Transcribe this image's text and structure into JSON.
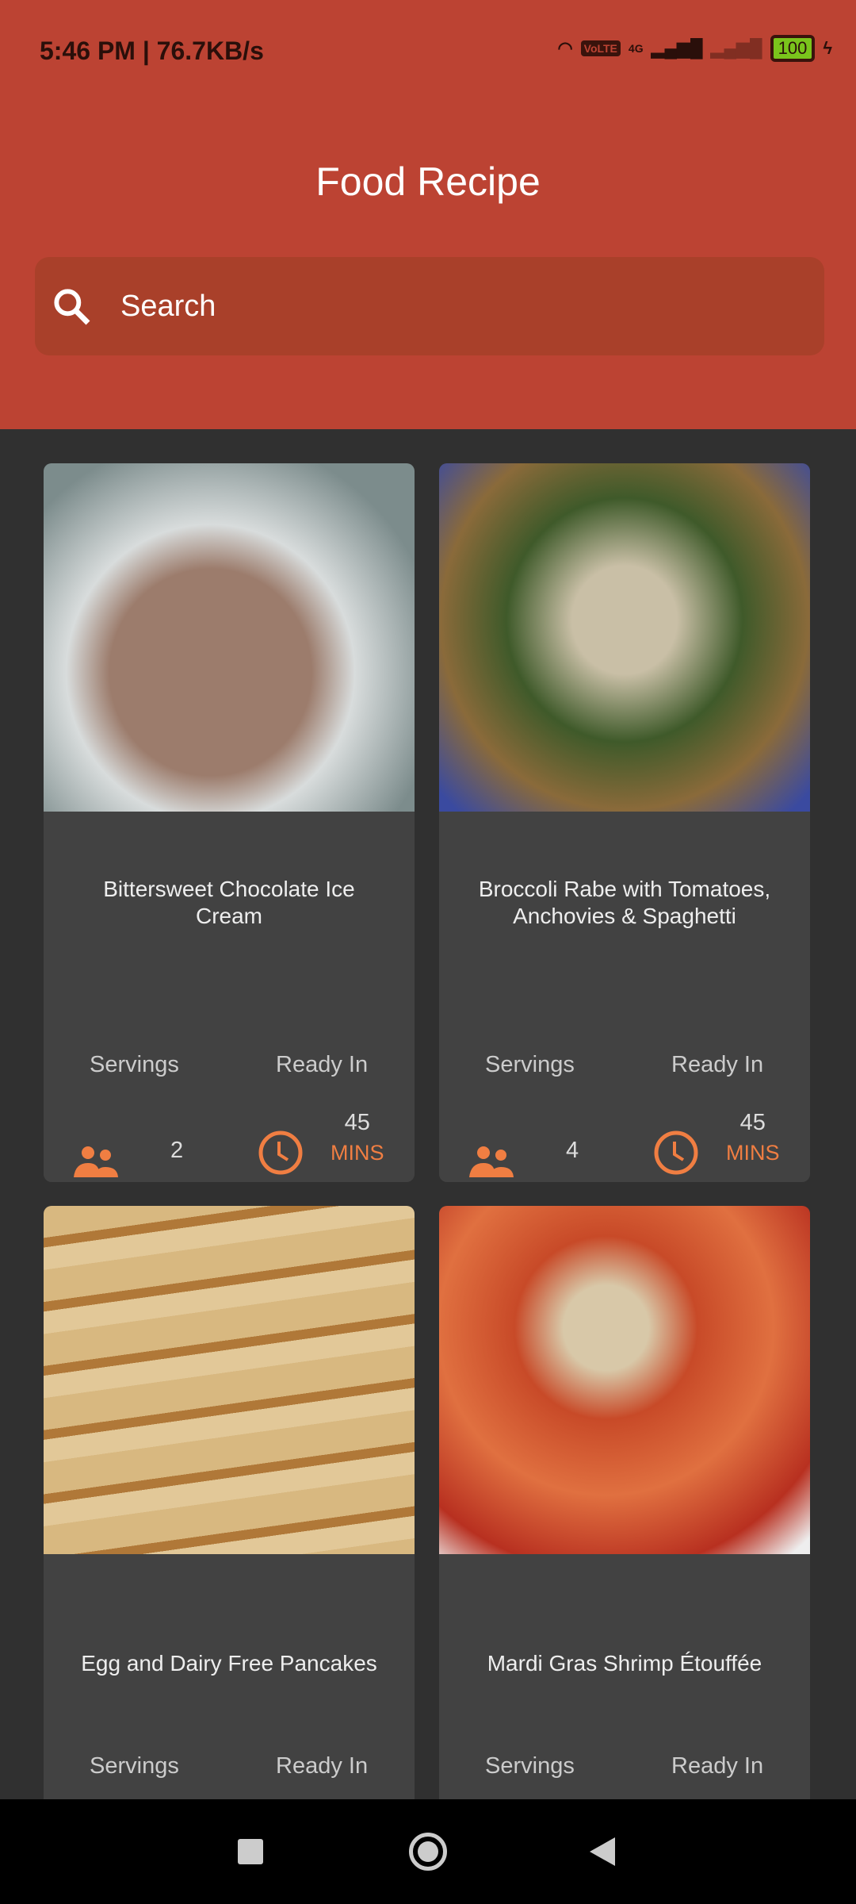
{
  "status_bar": {
    "time": "5:46 PM | 76.7KB/s",
    "network": "4G",
    "battery": "100"
  },
  "header": {
    "title": "Food Recipe"
  },
  "search": {
    "placeholder": "Search"
  },
  "recipes": [
    {
      "name": "Bittersweet Chocolate Ice Cream",
      "servings_label": "Servings",
      "servings": "2",
      "ready_label": "Ready In",
      "ready_value": "45",
      "ready_unit": "MINS"
    },
    {
      "name": "Broccoli Rabe with Tomatoes, Anchovies & Spaghetti",
      "servings_label": "Servings",
      "servings": "4",
      "ready_label": "Ready In",
      "ready_value": "45",
      "ready_unit": "MINS"
    },
    {
      "name": "Egg and Dairy Free Pancakes",
      "servings_label": "Servings",
      "ready_label": "Ready In"
    },
    {
      "name": "Mardi Gras Shrimp Étouffée",
      "servings_label": "Servings",
      "ready_label": "Ready In"
    }
  ],
  "colors": {
    "header": "#bc4333",
    "accent": "#f07e42",
    "card": "#424242",
    "background": "#303030"
  }
}
